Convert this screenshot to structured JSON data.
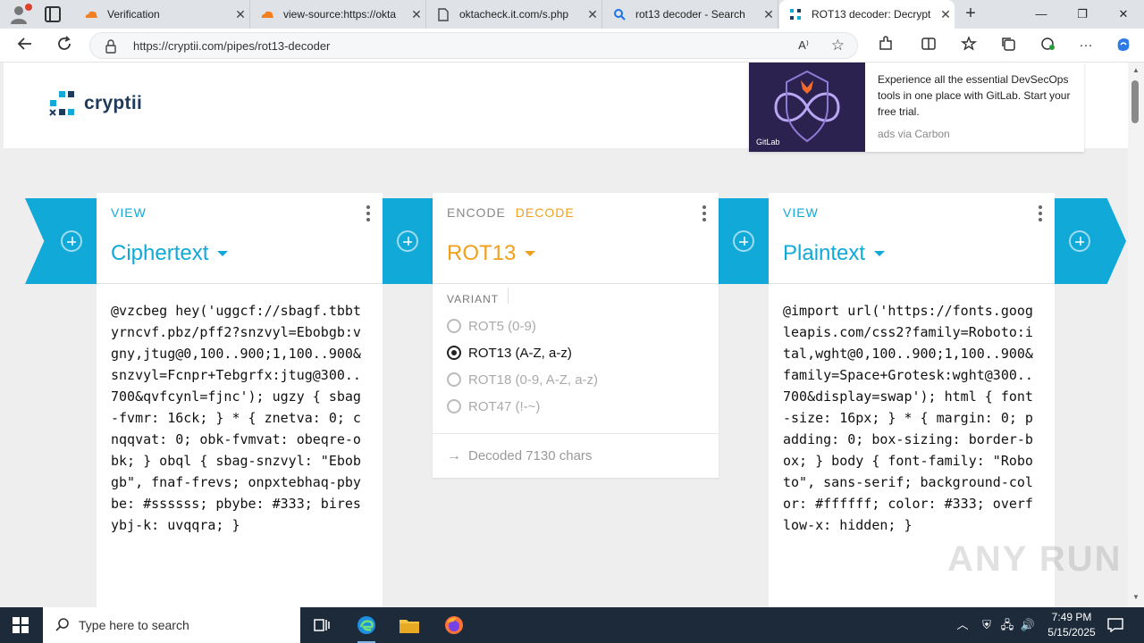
{
  "browser": {
    "tabs": [
      {
        "title": "Verification",
        "icon": "cloudflare-icon"
      },
      {
        "title": "view-source:https://okta",
        "icon": "cloudflare-icon"
      },
      {
        "title": "oktacheck.it.com/s.php",
        "icon": "page-icon"
      },
      {
        "title": "rot13 decoder - Search",
        "icon": "search-icon"
      },
      {
        "title": "ROT13 decoder: Decrypt",
        "icon": "cryptii-icon"
      }
    ],
    "new_tab": "+",
    "window_controls": {
      "minimize": "—",
      "maximize": "❐",
      "close": "✕"
    },
    "url": "https://cryptii.com/pipes/rot13-decoder",
    "read_aloud": "A⁾"
  },
  "site": {
    "logo_name": "cryptii"
  },
  "ad": {
    "text": "Experience all the essential DevSecOps tools in one place with GitLab. Start your free trial.",
    "via": "ads via Carbon",
    "brand": "GitLab"
  },
  "bricks": {
    "ciphertext": {
      "kind": "VIEW",
      "title": "Ciphertext",
      "content": "@vzcbeg hey('uggcf://sbagf.tbbtyrncvf.pbz/pff2?snzvyl=Ebobgb:vgny,jtug@0,100..900;1,100..900&snzvyl=Fcnpr+Tebgrfx:jtug@300..700&qvfcynl=fjnc'); ugzy { sbag-fvmr: 16ck; } * { znetva: 0; cnqqvat: 0; obk-fvmvat: obeqre-obk; } obql { sbag-snzvyl: \"Ebobgb\", fnaf-frevs; onpxtebhaq-pbybe: #ssssss; pbybe: #333; biresybj-k: uvqqra; }"
    },
    "rot13": {
      "kind_encode": "ENCODE",
      "kind_decode": "DECODE",
      "title": "ROT13",
      "variant_label": "VARIANT",
      "variants": [
        {
          "label": "ROT5 (0-9)",
          "selected": false
        },
        {
          "label": "ROT13 (A-Z, a-z)",
          "selected": true
        },
        {
          "label": "ROT18 (0-9, A-Z, a-z)",
          "selected": false
        },
        {
          "label": "ROT47 (!-~)",
          "selected": false
        }
      ],
      "status": "Decoded 7130 chars"
    },
    "plaintext": {
      "kind": "VIEW",
      "title": "Plaintext",
      "content": "@import url('https://fonts.googleapis.com/css2?family=Roboto:ital,wght@0,100..900;1,100..900&family=Space+Grotesk:wght@300..700&display=swap'); html { font-size: 16px; } * { margin: 0; padding: 0; box-sizing: border-box; } body { font-family: \"Roboto\", sans-serif; background-color: #ffffff; color: #333; overflow-x: hidden; }"
    }
  },
  "colors": {
    "accent_blue": "#10a9d8",
    "accent_orange": "#f0a01c"
  },
  "watermark": "ANY RUN",
  "taskbar": {
    "search_placeholder": "Type here to search",
    "time": "7:49 PM",
    "date": "5/15/2025"
  }
}
